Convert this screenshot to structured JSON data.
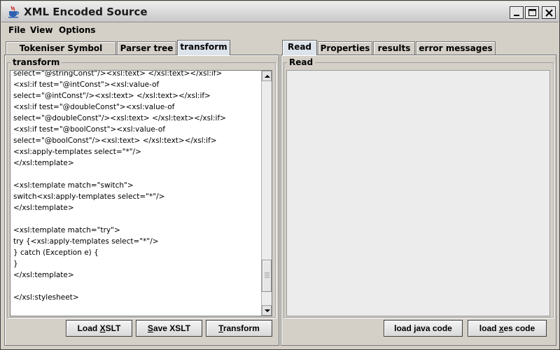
{
  "window": {
    "title": "XML Encoded Source"
  },
  "menu": [
    "File",
    "View",
    "Options"
  ],
  "left_panel": {
    "tabs": [
      "Tokeniser Symbol Table",
      "Parser tree",
      "transform"
    ],
    "active_tab": "transform",
    "group_label": "transform",
    "code_lines": [
      "select=\"@stringConst\"/><xsl:text> </xsl:text></xsl:if>",
      "<xsl:if test=\"@intConst\"><xsl:value-of",
      "select=\"@intConst\"/><xsl:text> </xsl:text></xsl:if>",
      "<xsl:if test=\"@doubleConst\"><xsl:value-of",
      "select=\"@doubleConst\"/><xsl:text> </xsl:text></xsl:if>",
      "<xsl:if test=\"@boolConst\"><xsl:value-of",
      "select=\"@boolConst\"/><xsl:text> </xsl:text></xsl:if>",
      "<xsl:apply-templates select=\"*\"/>",
      "</xsl:template>",
      "",
      "<xsl:template match=\"switch\">",
      "switch<xsl:apply-templates select=\"*\"/>",
      "</xsl:template>",
      "",
      "<xsl:template match=\"try\">",
      "try {<xsl:apply-templates select=\"*\"/>",
      "} catch (Exception e) {",
      "}",
      "</xsl:template>",
      "",
      "</xsl:stylesheet>"
    ],
    "scroll_position": 0.93,
    "buttons": [
      "Load XSLT",
      "Save XSLT",
      "Transform"
    ]
  },
  "right_panel": {
    "tabs": [
      "Read",
      "Properties",
      "results",
      "error messages"
    ],
    "active_tab": "Read",
    "group_label": "Read",
    "buttons": [
      "load java code",
      "load xes code"
    ]
  }
}
